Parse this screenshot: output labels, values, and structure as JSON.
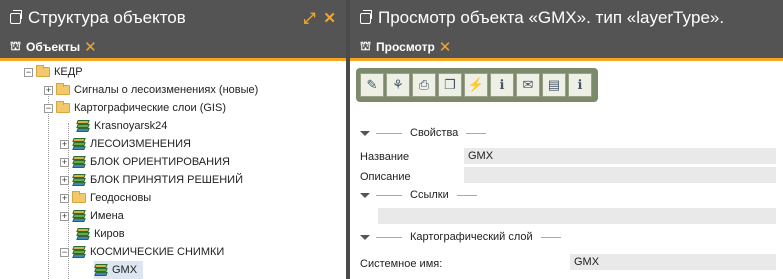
{
  "left_panel": {
    "title": "Структура объектов",
    "tab_label": "Объекты",
    "tree": {
      "root": "КЕДР",
      "items": [
        "Сигналы о лесоизменениях (новые)",
        "Картографические слои (GIS)",
        "Krasnoyarsk24",
        "ЛЕСОИЗМЕНЕНИЯ",
        "БЛОК ОРИЕНТИРОВАНИЯ",
        "БЛОК ПРИНЯТИЯ РЕШЕНИЙ",
        "Геодосновы",
        "Имена",
        "Киров",
        "КОСМИЧЕСКИЕ СНИМКИ",
        "GMX"
      ]
    }
  },
  "right_panel": {
    "title": "Просмотр объекта «GMX». тип «layerType».",
    "tab_label": "Просмотр",
    "sections": {
      "properties": "Свойства",
      "links": "Ссылки",
      "map_layer": "Картографический слой"
    },
    "fields": {
      "name_label": "Название",
      "name_value": "GMX",
      "description_label": "Описание",
      "description_value": "",
      "system_name_label": "Системное имя:",
      "system_name_value": "GMX"
    }
  },
  "icons": {
    "close": "close-icon",
    "expand": "expand-icon",
    "objects": "objects-icon"
  },
  "colors": {
    "header_bg": "#545454",
    "accent": "#f5a623",
    "toolbar_bg": "#7a8a6a"
  }
}
